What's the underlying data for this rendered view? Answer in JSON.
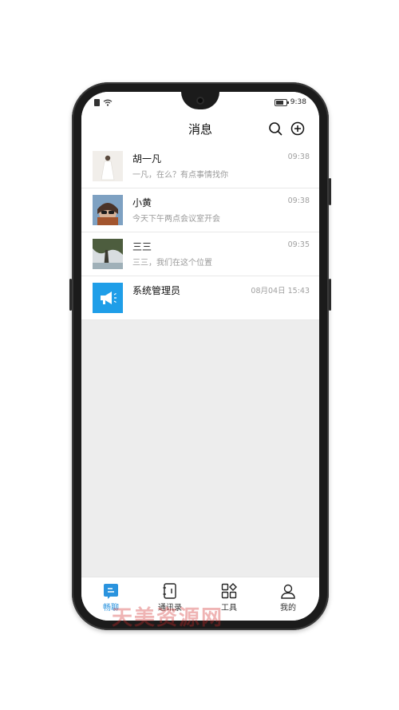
{
  "status_bar": {
    "time": "9:38"
  },
  "header": {
    "title": "消息"
  },
  "conversations": [
    {
      "name": "胡一凡",
      "preview": "一凡，在么？有点事情找你",
      "time": "09:38",
      "avatar": "photo-woman-white-dress-avatar"
    },
    {
      "name": "小黄",
      "preview": "今天下午两点会议室开会",
      "time": "09:38",
      "avatar": "photo-girl-sunglasses-avatar"
    },
    {
      "name": "三三",
      "preview": "三三，我们在这个位置",
      "time": "09:35",
      "avatar": "photo-tree-avatar"
    },
    {
      "name": "系统管理员",
      "preview": "",
      "time": "08月04日 15:43",
      "avatar": "megaphone-icon"
    }
  ],
  "tabs": [
    {
      "label": "畅聊",
      "icon": "chat-icon",
      "active": true
    },
    {
      "label": "通讯录",
      "icon": "contacts-icon",
      "active": false
    },
    {
      "label": "工具",
      "icon": "tools-icon",
      "active": false
    },
    {
      "label": "我的",
      "icon": "profile-icon",
      "active": false
    }
  ],
  "watermark": "天美资源网",
  "colors": {
    "accent": "#2a93de",
    "system_avatar": "#1f9ee8",
    "background": "#ededed"
  }
}
